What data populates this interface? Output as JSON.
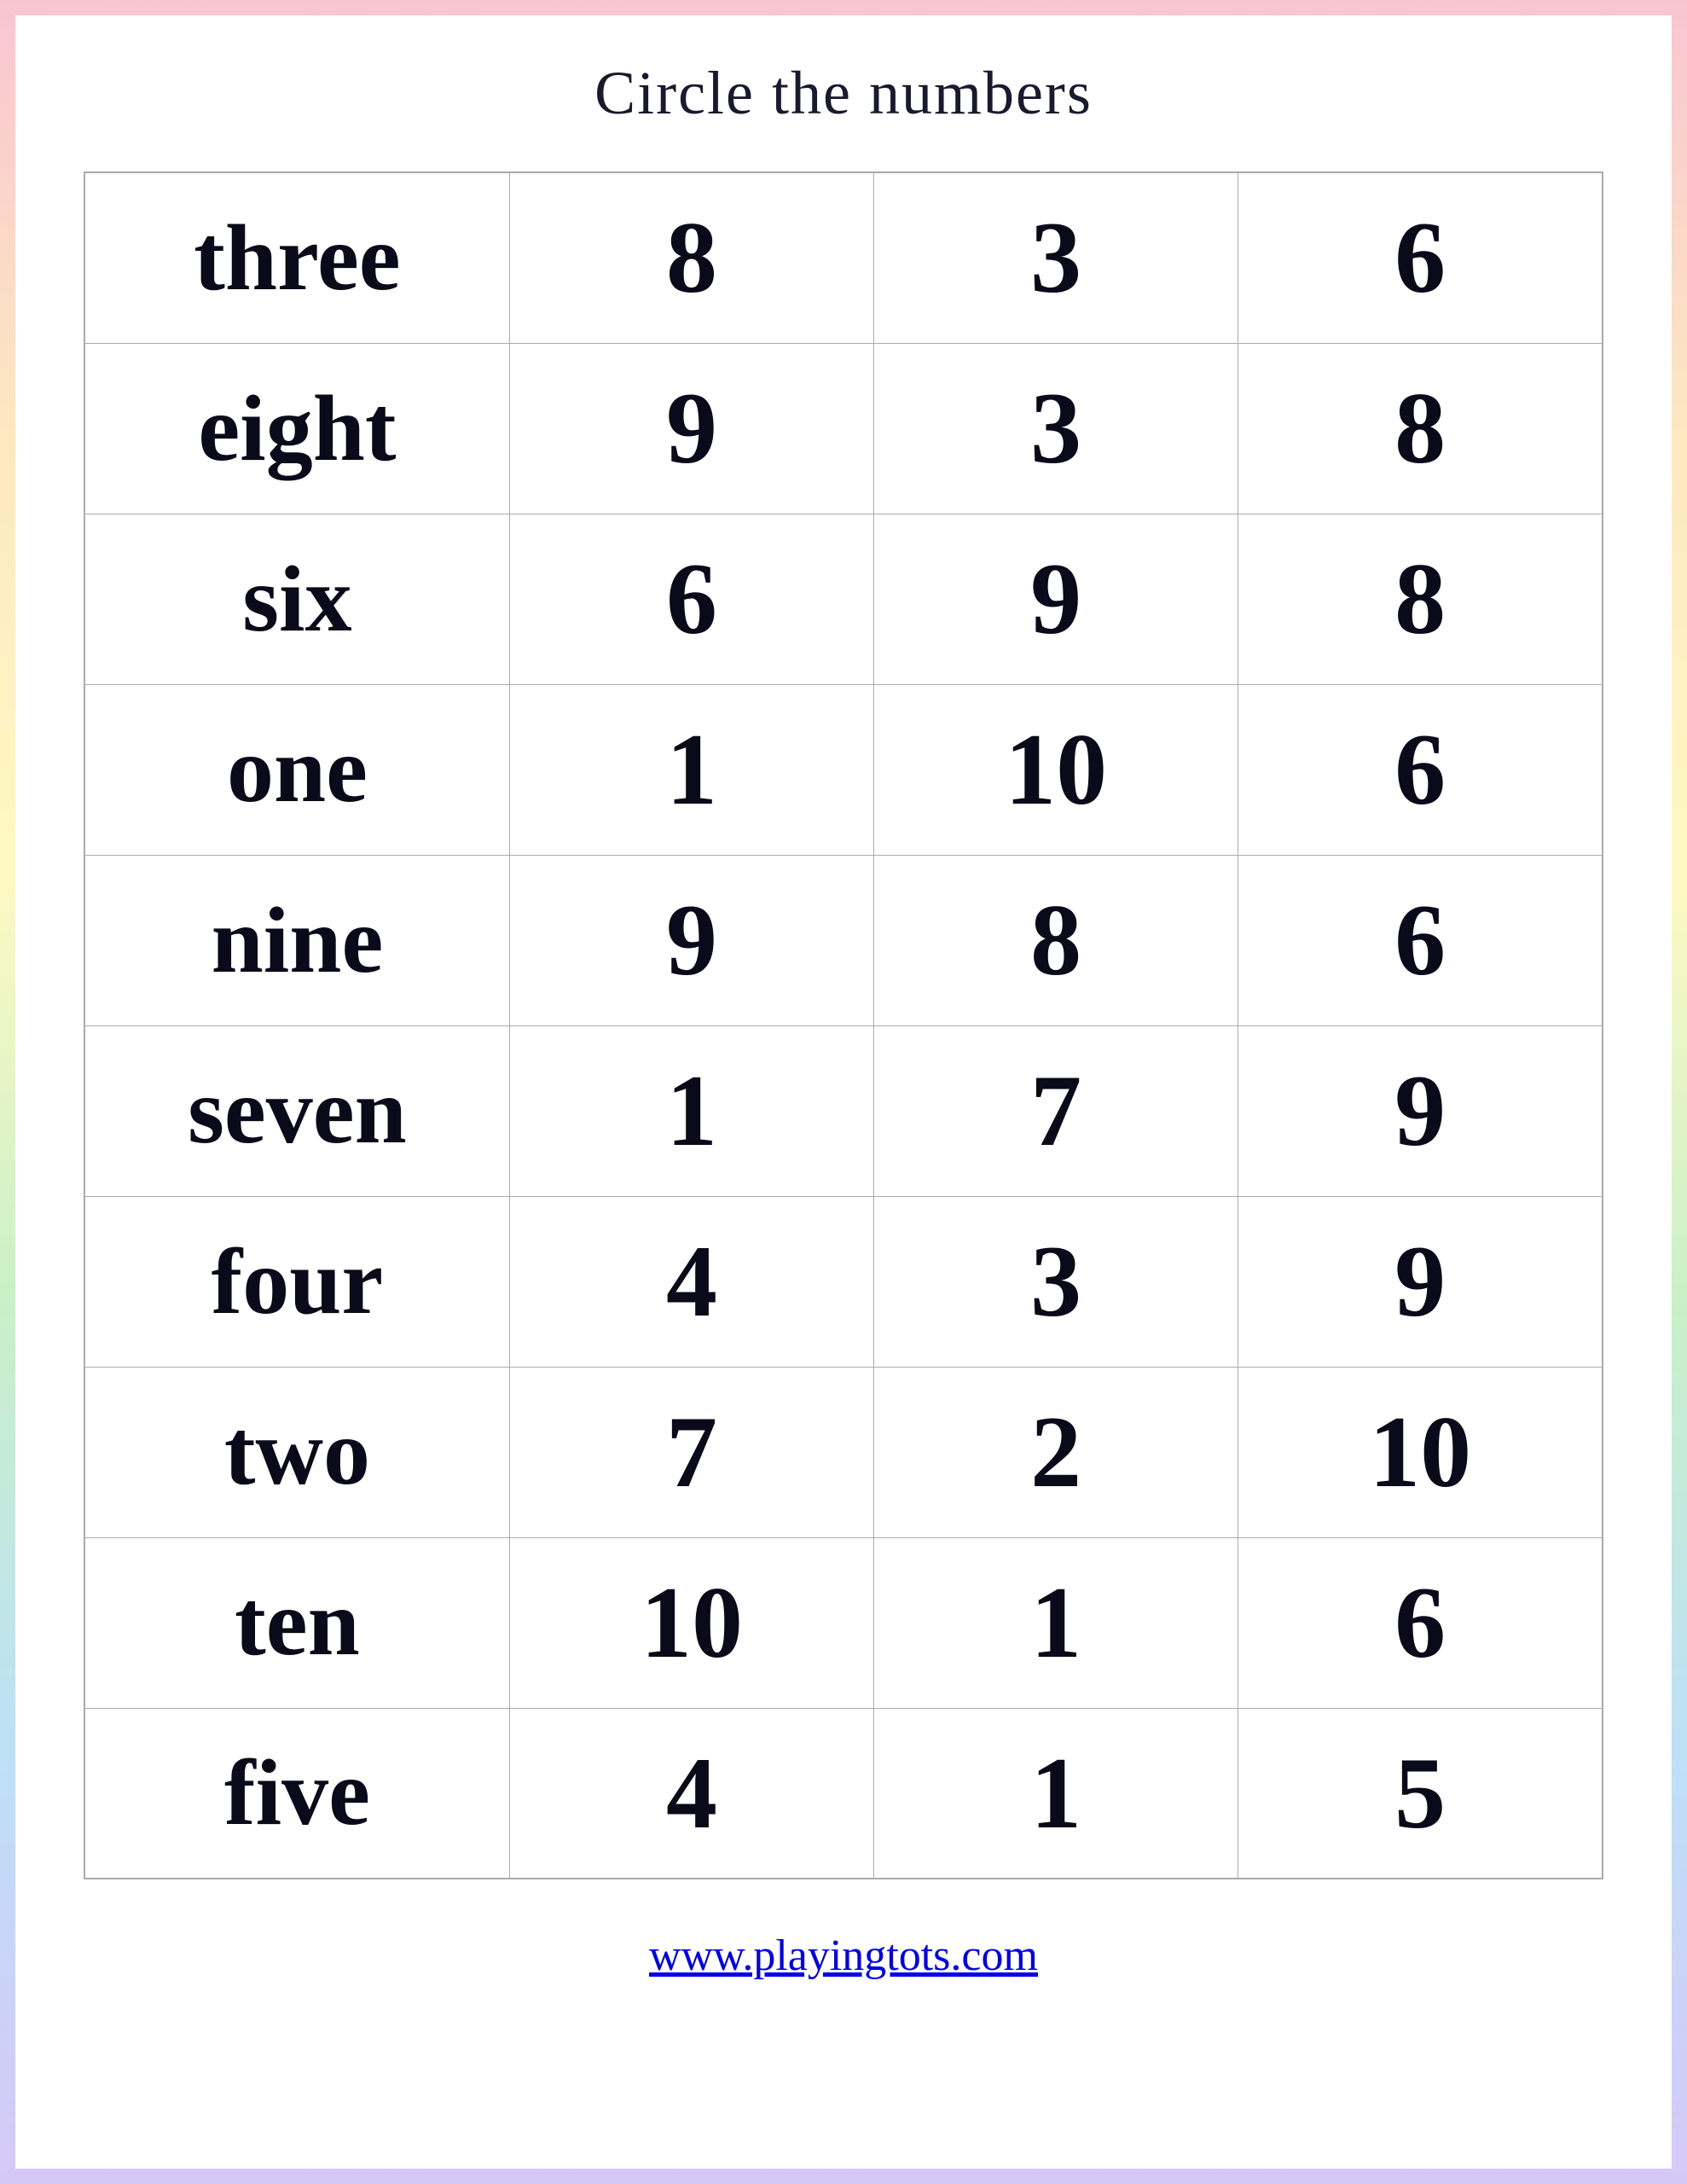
{
  "title": "Circle the numbers",
  "rows": [
    {
      "word": "three",
      "n1": "8",
      "n2": "3",
      "n3": "6"
    },
    {
      "word": "eight",
      "n1": "9",
      "n2": "3",
      "n3": "8"
    },
    {
      "word": "six",
      "n1": "6",
      "n2": "9",
      "n3": "8"
    },
    {
      "word": "one",
      "n1": "1",
      "n2": "10",
      "n3": "6"
    },
    {
      "word": "nine",
      "n1": "9",
      "n2": "8",
      "n3": "6"
    },
    {
      "word": "seven",
      "n1": "1",
      "n2": "7",
      "n3": "9"
    },
    {
      "word": "four",
      "n1": "4",
      "n2": "3",
      "n3": "9"
    },
    {
      "word": "two",
      "n1": "7",
      "n2": "2",
      "n3": "10"
    },
    {
      "word": "ten",
      "n1": "10",
      "n2": "1",
      "n3": "6"
    },
    {
      "word": "five",
      "n1": "4",
      "n2": "1",
      "n3": "5"
    }
  ],
  "footer_link": "www.playingtots.com",
  "colors": {
    "border_gradient_start": "#f9c5d1",
    "border_gradient_end": "#d5c8f7",
    "text": "#0a0a1a",
    "link": "#3a8fd4"
  }
}
